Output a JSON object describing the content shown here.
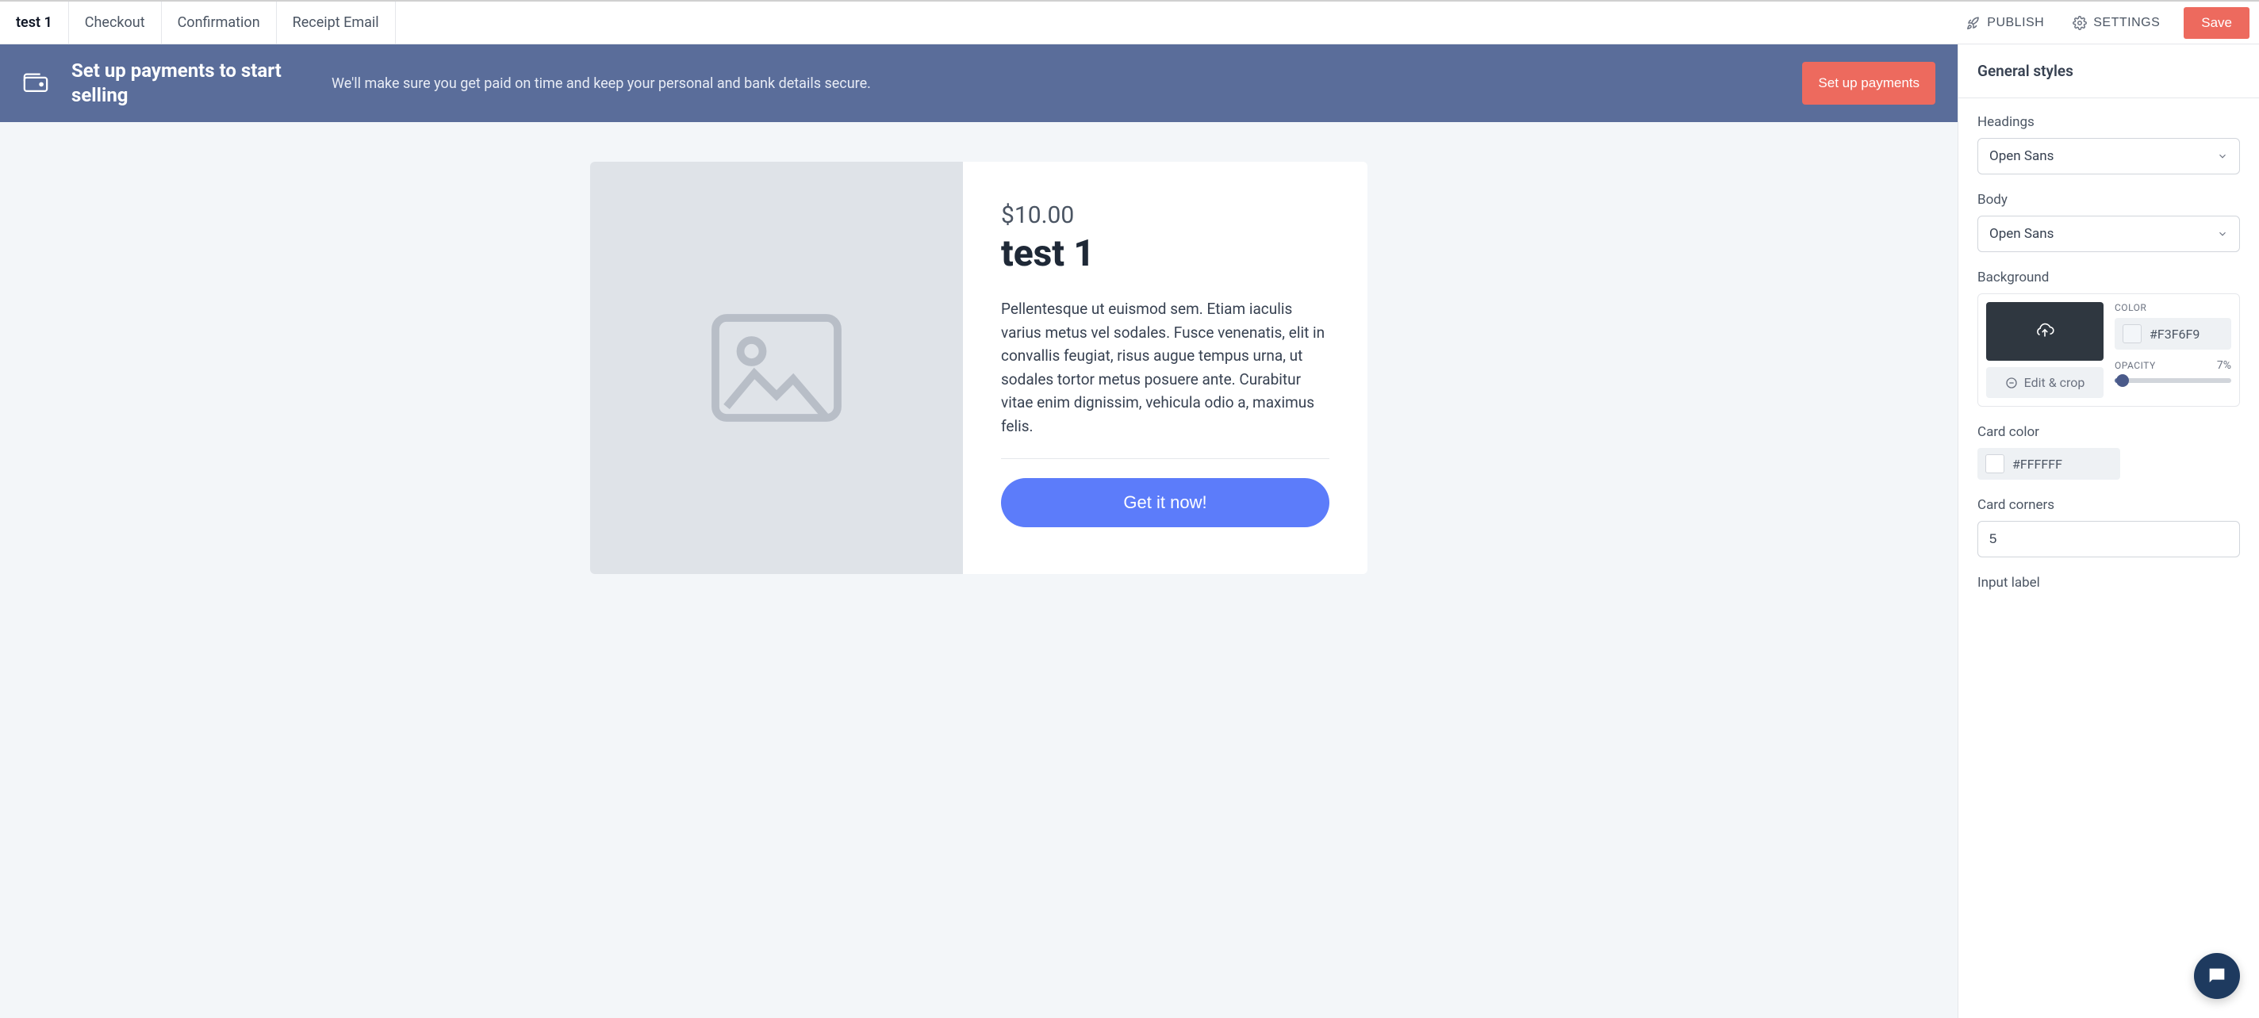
{
  "tabs": [
    {
      "label": "test 1",
      "active": true
    },
    {
      "label": "Checkout",
      "active": false
    },
    {
      "label": "Confirmation",
      "active": false
    },
    {
      "label": "Receipt Email",
      "active": false
    }
  ],
  "topbar": {
    "publish": "PUBLISH",
    "settings": "SETTINGS",
    "save": "Save"
  },
  "banner": {
    "title": "Set up payments to start selling",
    "desc": "We'll make sure you get paid on time and keep your personal and bank details secure.",
    "button": "Set up payments"
  },
  "product": {
    "price": "$10.00",
    "title": "test 1",
    "desc": "Pellentesque ut euismod sem. Etiam iaculis varius metus vel sodales. Fusce venenatis, elit in convallis feugiat, risus augue tempus urna, ut sodales tortor metus posuere ante. Curabitur vitae enim dignissim, vehicula odio a, maximus felis.",
    "cta": "Get it now!"
  },
  "panel": {
    "header": "General styles",
    "headings_label": "Headings",
    "headings_value": "Open Sans",
    "body_label": "Body",
    "body_value": "Open Sans",
    "background_label": "Background",
    "bg_color_label": "COLOR",
    "bg_color_value": "#F3F6F9",
    "opacity_label": "OPACITY",
    "opacity_value": "7%",
    "edit_crop": "Edit & crop",
    "card_color_label": "Card color",
    "card_color_value": "#FFFFFF",
    "card_corners_label": "Card corners",
    "card_corners_value": "5",
    "input_label_label": "Input label"
  }
}
